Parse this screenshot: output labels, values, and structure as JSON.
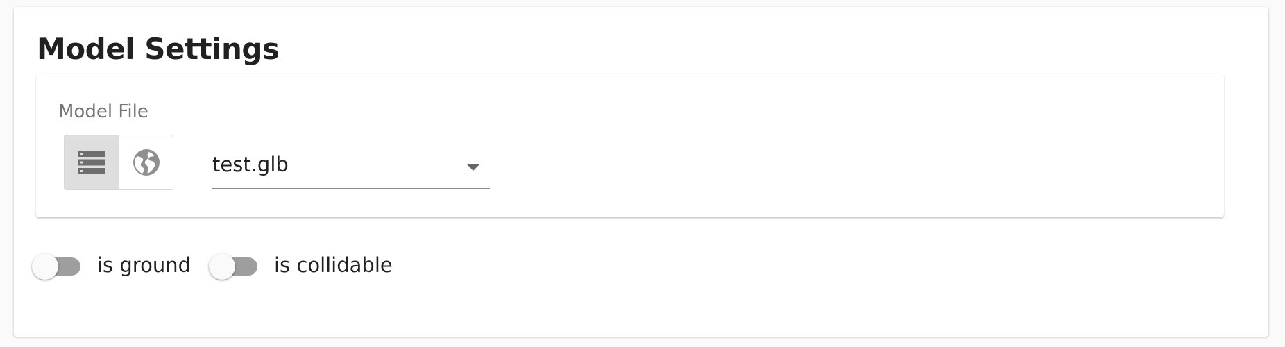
{
  "panel": {
    "title": "Model Settings"
  },
  "model_file": {
    "label": "Model File",
    "source_buttons": [
      {
        "icon": "storage-icon",
        "state": "selected"
      },
      {
        "icon": "globe-icon",
        "state": "unselected"
      }
    ],
    "select": {
      "value": "test.glb",
      "caret_icon": "dropdown-arrow-icon"
    }
  },
  "toggles": [
    {
      "label": "is ground",
      "checked": false
    },
    {
      "label": "is collidable",
      "checked": false
    }
  ],
  "colors": {
    "accent_selected_bg": "#dedede",
    "icon_gray": "#6e6e6e",
    "track_off": "#9e9e9e"
  }
}
